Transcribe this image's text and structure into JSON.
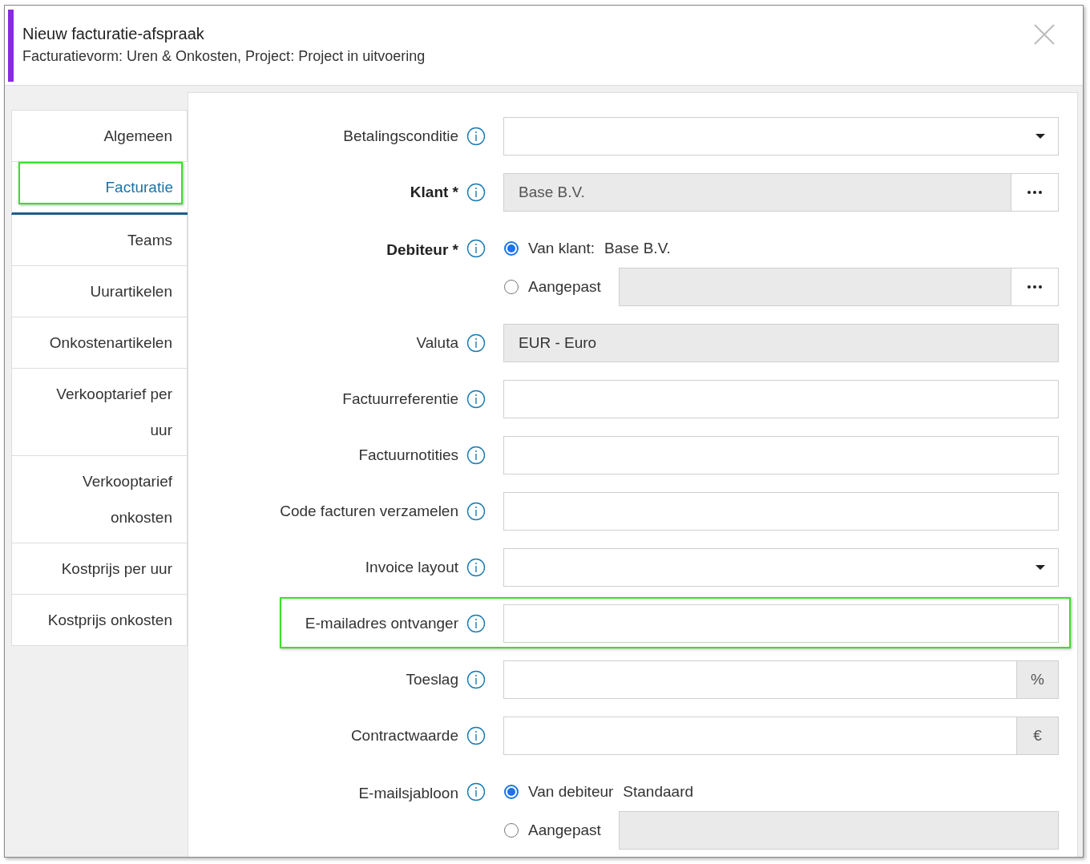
{
  "dialog": {
    "title": "Nieuw facturatie-afspraak",
    "subtitle": "Facturatievorm: Uren & Onkosten, Project: Project in uitvoering"
  },
  "tabs": [
    {
      "label": "Algemeen",
      "selected": false,
      "highlighted": false
    },
    {
      "label": "Facturatie",
      "selected": true,
      "highlighted": true
    },
    {
      "label": "Teams",
      "selected": false,
      "highlighted": false
    },
    {
      "label": "Uurartikelen",
      "selected": false,
      "highlighted": false
    },
    {
      "label": "Onkostenartikelen",
      "selected": false,
      "highlighted": false
    },
    {
      "label": "Verkooptarief per uur",
      "selected": false,
      "highlighted": false
    },
    {
      "label": "Verkooptarief onkosten",
      "selected": false,
      "highlighted": false
    },
    {
      "label": "Kostprijs per uur",
      "selected": false,
      "highlighted": false
    },
    {
      "label": "Kostprijs onkosten",
      "selected": false,
      "highlighted": false
    }
  ],
  "fields": [
    {
      "kind": "select",
      "label": "Betalingsconditie",
      "required": false,
      "highlighted": false
    },
    {
      "kind": "lookup",
      "label": "Klant *",
      "required": true,
      "highlighted": false,
      "value": "Base B.V."
    },
    {
      "kind": "radio",
      "label": "Debiteur *",
      "required": true,
      "highlighted": false,
      "options": [
        {
          "kind": "detail",
          "label": "Van klant:",
          "detail": "Base B.V.",
          "selected": true
        },
        {
          "kind": "lookup",
          "label": "Aangepast",
          "selected": false
        }
      ]
    },
    {
      "kind": "readonly",
      "label": "Valuta",
      "required": false,
      "highlighted": false,
      "value": "EUR - Euro"
    },
    {
      "kind": "text",
      "label": "Factuurreferentie",
      "required": false,
      "highlighted": false
    },
    {
      "kind": "text",
      "label": "Factuurnotities",
      "required": false,
      "highlighted": false
    },
    {
      "kind": "text",
      "label": "Code facturen verzamelen",
      "required": false,
      "highlighted": false
    },
    {
      "kind": "select",
      "label": "Invoice layout",
      "required": false,
      "highlighted": false
    },
    {
      "kind": "text",
      "label": "E-mailadres ontvanger",
      "required": false,
      "highlighted": true
    },
    {
      "kind": "addon",
      "label": "Toeslag",
      "required": false,
      "highlighted": false,
      "suffix": "%"
    },
    {
      "kind": "addon",
      "label": "Contractwaarde",
      "required": false,
      "highlighted": false,
      "suffix": "€"
    },
    {
      "kind": "radio",
      "label": "E-mailsjabloon",
      "required": false,
      "highlighted": false,
      "options": [
        {
          "kind": "detail",
          "label": "Van debiteur",
          "detail": "Standaard",
          "selected": true
        },
        {
          "kind": "readonly",
          "label": "Aangepast",
          "selected": false
        }
      ]
    }
  ]
}
